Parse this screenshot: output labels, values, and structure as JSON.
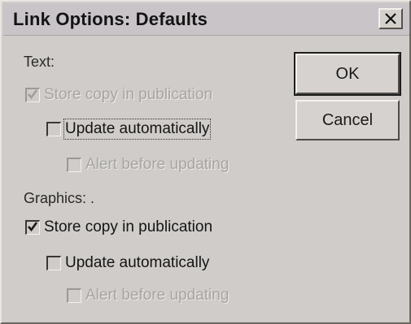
{
  "dialog": {
    "title": "Link Options: Defaults",
    "close_icon": "close-x-icon"
  },
  "text_group": {
    "label": "Text:",
    "store_copy": {
      "label": "Store copy in publication",
      "checked": true,
      "enabled": false
    },
    "update_auto": {
      "label": "Update automatically",
      "checked": false,
      "enabled": true
    },
    "alert_before": {
      "label": "Alert before updating",
      "checked": false,
      "enabled": false
    }
  },
  "graphics_group": {
    "label": "Graphics: .",
    "store_copy": {
      "label": "Store copy in publication",
      "checked": true,
      "enabled": true
    },
    "update_auto": {
      "label": "Update automatically",
      "checked": false,
      "enabled": true
    },
    "alert_before": {
      "label": "Alert before updating",
      "checked": false,
      "enabled": false
    }
  },
  "buttons": {
    "ok_label": "OK",
    "cancel_label": "Cancel"
  },
  "colors": {
    "face": "#cfccc9",
    "disabled_text": "#a8a5a1"
  }
}
